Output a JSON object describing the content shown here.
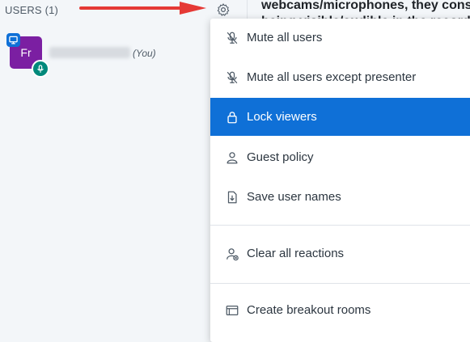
{
  "users_panel": {
    "header": "USERS (1)",
    "user": {
      "initials": "Fr",
      "you_label": "(You)"
    }
  },
  "chat_background_text": {
    "line1": "webcams/microphones, they cons",
    "line2": "being visible/audible in the recordi"
  },
  "colors": {
    "accent": "#0f70d7",
    "avatar": "#7b1fa2",
    "voice_badge": "#00897b",
    "arrow": "#e53935"
  },
  "menu": {
    "items": [
      {
        "label": "Mute all users",
        "icon": "mic-off-icon"
      },
      {
        "label": "Mute all users except presenter",
        "icon": "mic-off-icon"
      },
      {
        "label": "Lock viewers",
        "icon": "lock-icon",
        "active": true
      },
      {
        "label": "Guest policy",
        "icon": "user-icon"
      },
      {
        "label": "Save user names",
        "icon": "download-file-icon"
      },
      {
        "label": "Clear all reactions",
        "icon": "clear-reactions-icon"
      },
      {
        "label": "Create breakout rooms",
        "icon": "breakout-rooms-icon"
      }
    ]
  }
}
